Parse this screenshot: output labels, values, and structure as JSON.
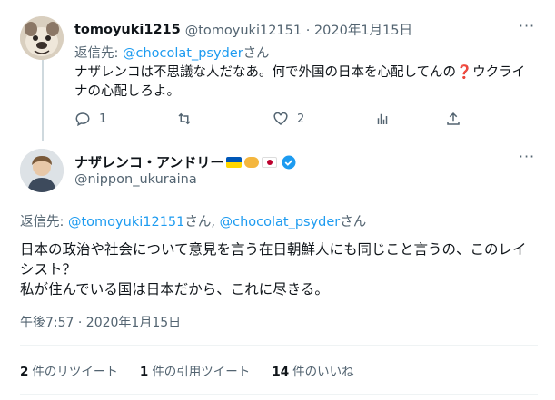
{
  "parent_tweet": {
    "display_name": "tomoyuki1215",
    "handle_time": "@tomoyuki12151 · 2020年1月15日",
    "reply_prefix": "返信先: ",
    "reply_to": "@chocolat_psyder",
    "reply_suffix": "さん",
    "text_part1": "ナザレンコは不思議な人だなあ。何で外国の日本を心配してんの",
    "text_qmark": "❓",
    "text_part2": "ウクライナの心配しろよ。",
    "reply_count": "1",
    "like_count": "2"
  },
  "main_tweet": {
    "display_name": "ナザレンコ・アンドリー",
    "handle": "@nippon_ukuraina",
    "reply_prefix": "返信先: ",
    "reply_to_1": "@tomoyuki12151",
    "reply_mid": "さん, ",
    "reply_to_2": "@chocolat_psyder",
    "reply_suffix": "さん",
    "text_line1": "日本の政治や社会について意見を言う在日朝鮮人にも同じこと言うの、このレイシスト？",
    "text_line2": "私が住んでいる国は日本だから、これに尽きる。",
    "timestamp": "午後7:57 · 2020年1月15日"
  },
  "stats": {
    "retweets_num": "2",
    "retweets_label": "件のリツイート",
    "quotes_num": "1",
    "quotes_label": "件の引用ツイート",
    "likes_num": "14",
    "likes_label": "件のいいね"
  },
  "colors": {
    "link": "#1d9bf0",
    "secondary_text": "#536471",
    "verified": "#1d9bf0"
  }
}
